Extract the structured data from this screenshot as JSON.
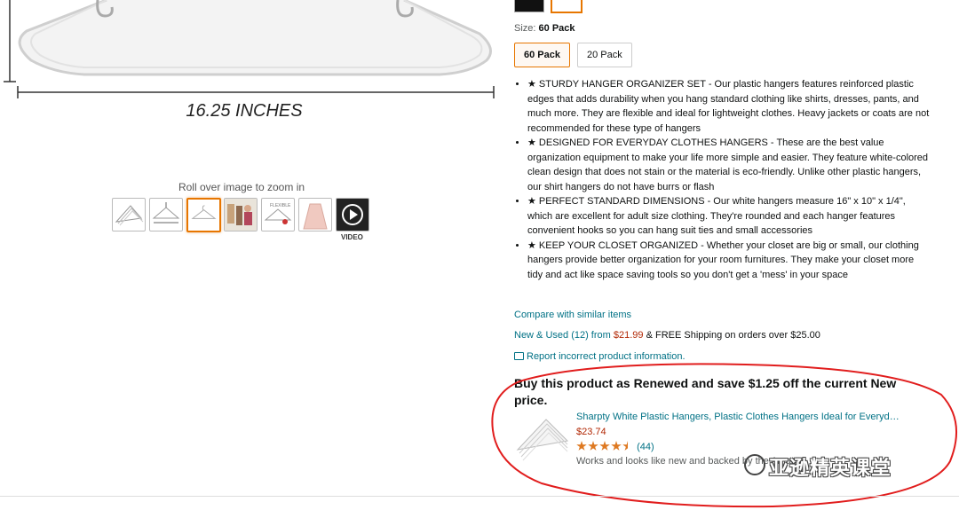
{
  "gallery": {
    "dimension_label": "16.25 INCHES",
    "zoom_hint": "Roll over image to zoom in",
    "video_label": "VIDEO",
    "thumbnails": [
      "stack-of-hangers",
      "hanger-diagram",
      "single-hanger",
      "closet-photo",
      "hanger-spec",
      "dress-on-hanger",
      "video"
    ],
    "selected_thumbnail": 2
  },
  "size": {
    "label": "Size:",
    "selected": "60 Pack",
    "options": [
      "60 Pack",
      "20 Pack"
    ]
  },
  "bullets": [
    "★ STURDY HANGER ORGANIZER SET - Our plastic hangers features reinforced plastic edges that adds durability when you hang standard clothing like shirts, dresses, pants, and much more. They are flexible and ideal for lightweight clothes. Heavy jackets or coats are not recommended for these type of hangers",
    "★ DESIGNED FOR EVERYDAY CLOTHES HANGERS - These are the best value organization equipment to make your life more simple and easier. They feature white-colored clean design that does not stain or the material is eco-friendly. Unlike other plastic hangers, our shirt hangers do not have burrs or flash",
    "★ PERFECT STANDARD DIMENSIONS - Our white hangers measure 16\" x 10\" x 1/4\", which are excellent for adult size clothing. They're rounded and each hanger features convenient hooks so you can hang suit ties and small accessories",
    "★ KEEP YOUR CLOSET ORGANIZED - Whether your closet are big or small, our clothing hangers provide better organization for your room furnitures. They make your closet more tidy and act like space saving tools so you don't get a 'mess' in your space"
  ],
  "links": {
    "compare": "Compare with similar items",
    "new_used": "New & Used (12) from",
    "new_used_price": "$21.99",
    "shipping": "& FREE Shipping on orders over $25.00",
    "report": "Report incorrect product information."
  },
  "renewed": {
    "title": "Buy this product as Renewed and save $1.25 off the current New price.",
    "product_link": "Sharpty White Plastic Hangers, Plastic Clothes Hangers Ideal for Everyd…",
    "price": "$23.74",
    "rating": 4.5,
    "review_count": "(44)",
    "note": "Works and looks like new and backed by the Amazon"
  },
  "watermark": "亚逊精英课堂",
  "colors": {
    "link": "#007185",
    "price": "#b12704",
    "star": "#de7921",
    "selected_border": "#e77600",
    "annotation": "#e11d1d"
  }
}
